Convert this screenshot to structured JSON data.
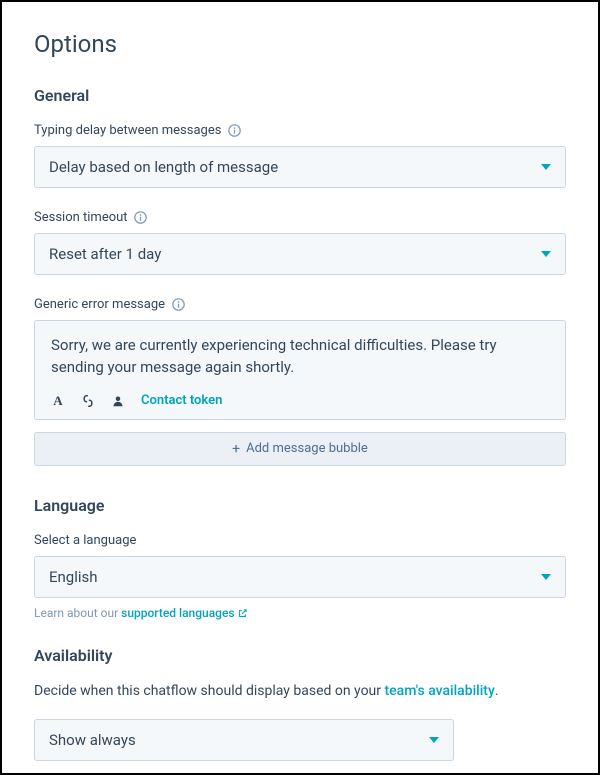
{
  "page_title": "Options",
  "sections": {
    "general": {
      "header": "General",
      "typing_delay": {
        "label": "Typing delay between messages",
        "value": "Delay based on length of message"
      },
      "session_timeout": {
        "label": "Session timeout",
        "value": "Reset after 1 day"
      },
      "generic_error": {
        "label": "Generic error message",
        "message": "Sorry, we are currently experiencing technical difficulties. Please try sending your message again shortly.",
        "contact_token": "Contact token",
        "add_bubble": "Add message bubble"
      }
    },
    "language": {
      "header": "Language",
      "label": "Select a language",
      "value": "English",
      "help_prefix": "Learn about our ",
      "help_link": "supported languages"
    },
    "availability": {
      "header": "Availability",
      "description_prefix": "Decide when this chatflow should display based on your ",
      "description_link": "team's availability",
      "description_suffix": ".",
      "value": "Show always"
    }
  }
}
